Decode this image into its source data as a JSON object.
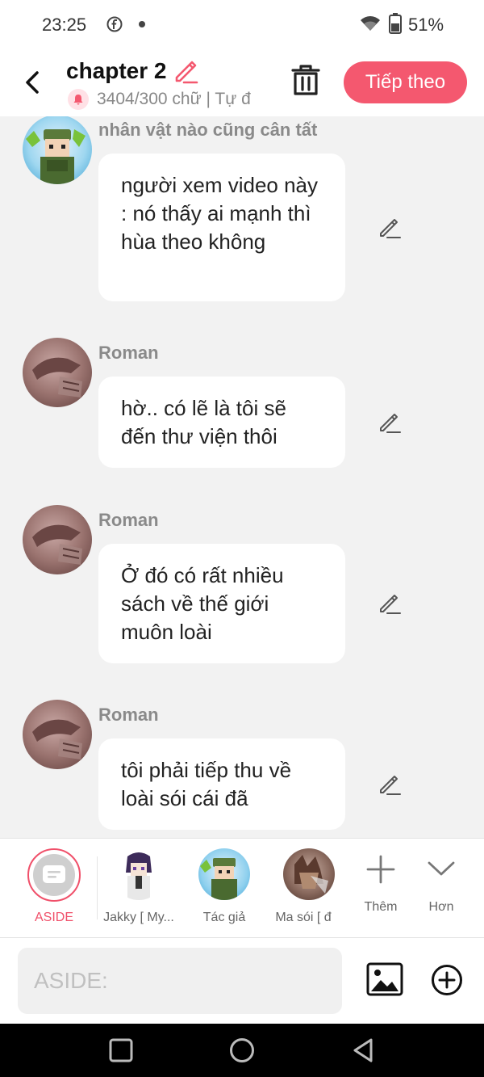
{
  "status_bar": {
    "time": "23:25",
    "battery": "51%"
  },
  "header": {
    "title": "chapter 2",
    "word_count": "3404/300 chữ | Tự đ",
    "next_label": "Tiếp theo"
  },
  "messages": [
    {
      "character": "nhân vật nào cũng cân tất",
      "text": "người xem video này : nó thấy ai mạnh thì hùa theo không"
    },
    {
      "character": "Roman",
      "text": "hờ.. có lẽ là tôi sẽ đến thư viện thôi"
    },
    {
      "character": "Roman",
      "text": "Ở đó có rất nhiều sách về thế giới muôn loài"
    },
    {
      "character": "Roman",
      "text": "tôi phải tiếp thu về loài sói cái đã"
    }
  ],
  "toolbar": {
    "aside_label": "ASIDE",
    "characters": [
      {
        "label": "Jakky [ My..."
      },
      {
        "label": "Tác giả"
      },
      {
        "label": "Ma sói [ đ"
      }
    ],
    "add_label": "Thêm",
    "more_label": "Hơn"
  },
  "input": {
    "placeholder": "ASIDE:"
  },
  "colors": {
    "accent": "#f4586f",
    "background": "#f2f2f2"
  }
}
